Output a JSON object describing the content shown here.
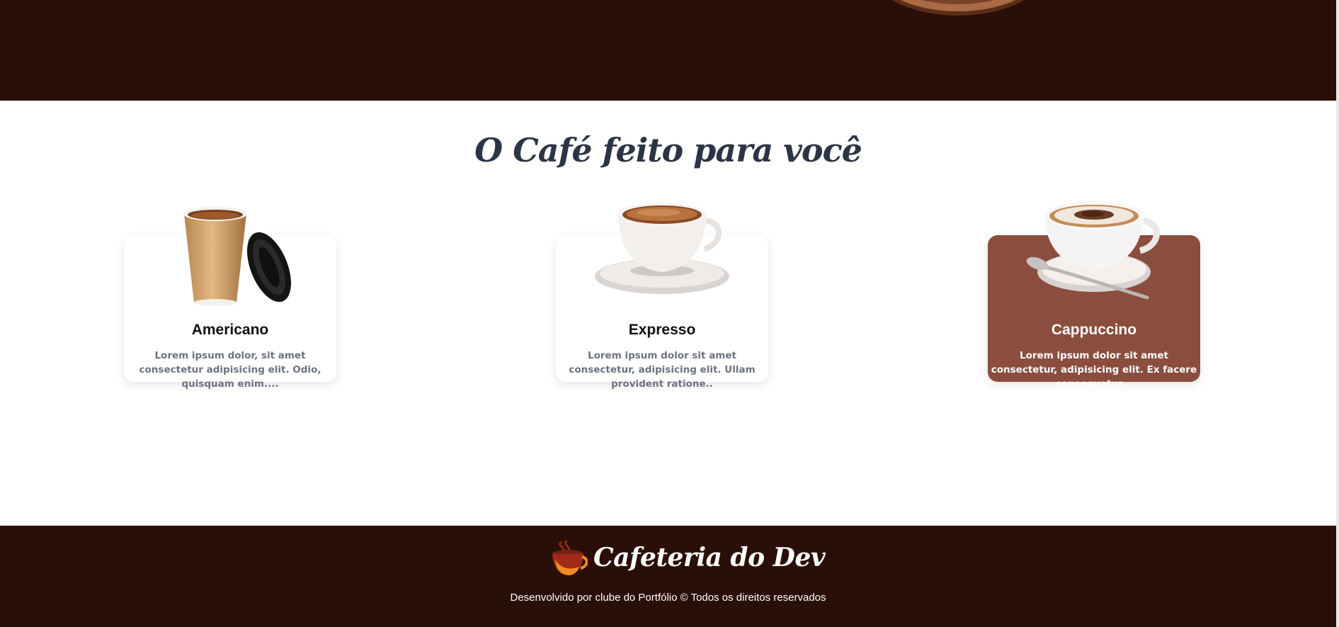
{
  "section": {
    "title": "O Café feito para você"
  },
  "products": [
    {
      "name": "Americano",
      "image_icon": "paper-coffee-cup-icon",
      "description": "Lorem ipsum dolor, sit amet consectetur adipisicing elit. Odio, quisquam enim...."
    },
    {
      "name": "Expresso",
      "image_icon": "espresso-cup-icon",
      "description": "Lorem ipsum dolor sit amet consectetur, adipisicing elit. Ullam provident ratione.."
    },
    {
      "name": "Cappuccino",
      "image_icon": "cappuccino-cup-icon",
      "description": "Lorem ipsum dolor sit amet consectetur, adipisicing elit. Ex facere consequatur..."
    }
  ],
  "footer": {
    "brand": "Cafeteria do Dev",
    "logo_icon": "coffee-cup-logo-icon",
    "credit": "Desenvolvido por clube do Portfólio © Todos os direitos reservados"
  },
  "colors": {
    "dark_brown": "#2a0f08",
    "card_active": "#8b4d3e",
    "title": "#2c3546",
    "muted_text": "#6b7280"
  }
}
